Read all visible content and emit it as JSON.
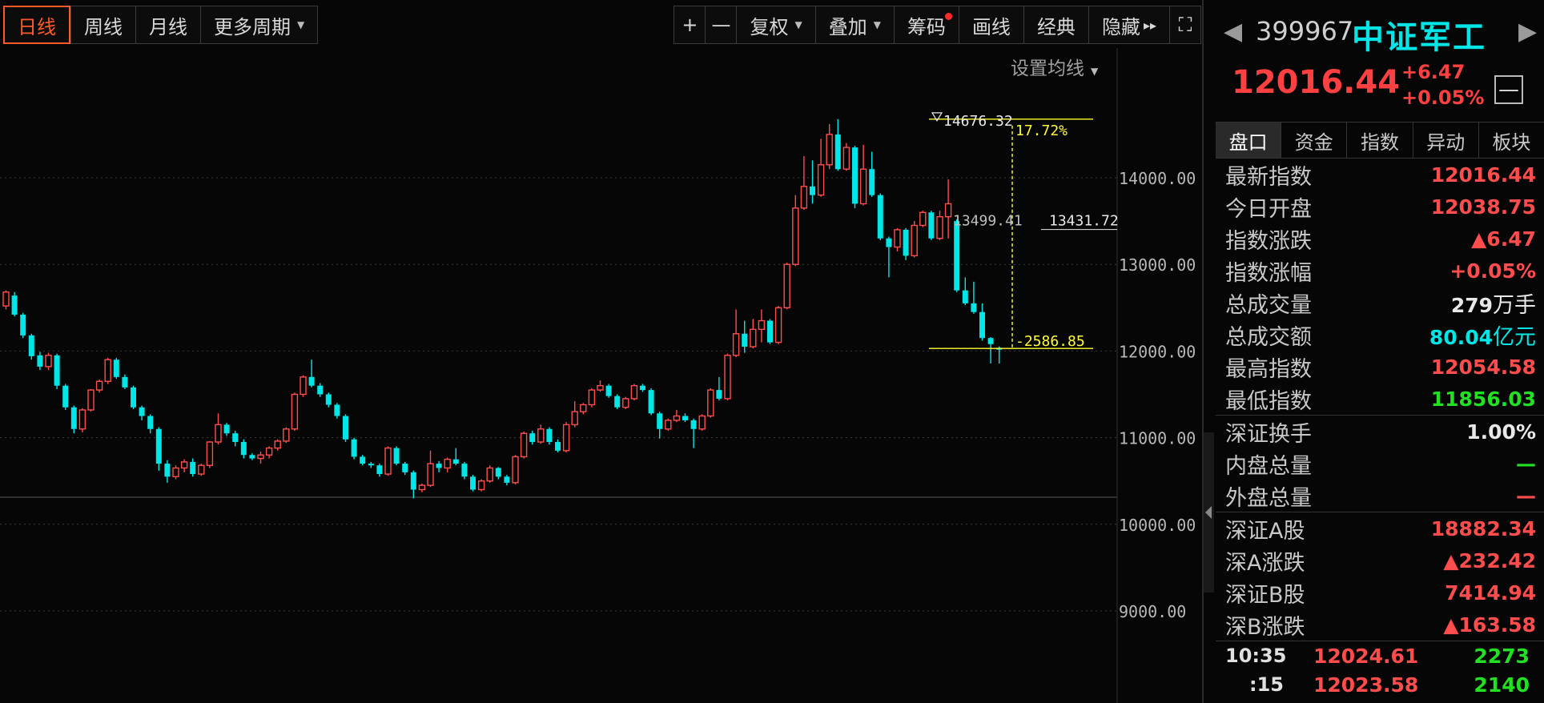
{
  "toolbar": {
    "periods": [
      "日线",
      "周线",
      "月线",
      "更多周期"
    ],
    "tools": [
      "复权",
      "叠加",
      "筹码",
      "画线",
      "经典",
      "隐藏"
    ],
    "plus_label": "+",
    "minus_label": "—",
    "hide_arrows": "▸▸",
    "expand_label": "⛶"
  },
  "chart": {
    "set_ma_label": "设置均线",
    "y_ticks": [
      "14000.00",
      "13000.00",
      "12000.00",
      "11000.00",
      "10000.00",
      "9000.00"
    ]
  },
  "chart_data": {
    "type": "candlestick",
    "y_axis_ticks": [
      14000,
      13000,
      12000,
      11000,
      10000,
      9000
    ],
    "annotations": {
      "high_label": "14676.32",
      "range_pct": "17.72%",
      "range_diff": "-2586.85",
      "mid_labels": [
        "13499.41",
        "13431.72"
      ]
    },
    "candles": [
      [
        12520,
        12680,
        12480,
        12700
      ],
      [
        12640,
        12420,
        12400,
        12680
      ],
      [
        12420,
        12180,
        12150,
        12440
      ],
      [
        12180,
        11940,
        11900,
        12200
      ],
      [
        11950,
        11820,
        11780,
        11990
      ],
      [
        11820,
        11950,
        11780,
        11980
      ],
      [
        11950,
        11600,
        11560,
        11970
      ],
      [
        11600,
        11350,
        11320,
        11620
      ],
      [
        11350,
        11100,
        11050,
        11370
      ],
      [
        11100,
        11320,
        11060,
        11340
      ],
      [
        11320,
        11550,
        11300,
        11560
      ],
      [
        11550,
        11650,
        11520,
        11670
      ],
      [
        11650,
        11900,
        11620,
        11920
      ],
      [
        11900,
        11700,
        11680,
        11920
      ],
      [
        11700,
        11580,
        11560,
        11730
      ],
      [
        11580,
        11350,
        11330,
        11600
      ],
      [
        11350,
        11250,
        11200,
        11370
      ],
      [
        11250,
        11100,
        11050,
        11270
      ],
      [
        11100,
        10700,
        10620,
        11120
      ],
      [
        10700,
        10550,
        10480,
        10740
      ],
      [
        10550,
        10650,
        10520,
        10680
      ],
      [
        10650,
        10720,
        10600,
        10750
      ],
      [
        10720,
        10580,
        10550,
        10760
      ],
      [
        10580,
        10680,
        10560,
        10700
      ],
      [
        10680,
        10950,
        10650,
        10960
      ],
      [
        10950,
        11150,
        10920,
        11280
      ],
      [
        11150,
        11050,
        11020,
        11170
      ],
      [
        11050,
        10950,
        10900,
        11080
      ],
      [
        10950,
        10800,
        10760,
        10980
      ],
      [
        10800,
        10760,
        10740,
        10820
      ],
      [
        10760,
        10800,
        10700,
        10840
      ],
      [
        10800,
        10880,
        10760,
        10900
      ],
      [
        10880,
        10960,
        10850,
        10980
      ],
      [
        10960,
        11100,
        10940,
        11120
      ],
      [
        11100,
        11500,
        11080,
        11520
      ],
      [
        11500,
        11700,
        11470,
        11720
      ],
      [
        11700,
        11600,
        11580,
        11900
      ],
      [
        11600,
        11500,
        11470,
        11630
      ],
      [
        11500,
        11380,
        11350,
        11520
      ],
      [
        11380,
        11250,
        11220,
        11400
      ],
      [
        11250,
        10980,
        10950,
        11270
      ],
      [
        10980,
        10780,
        10750,
        11000
      ],
      [
        10780,
        10700,
        10680,
        10800
      ],
      [
        10700,
        10680,
        10650,
        10720
      ],
      [
        10680,
        10580,
        10550,
        10700
      ],
      [
        10580,
        10880,
        10560,
        10900
      ],
      [
        10880,
        10700,
        10680,
        10900
      ],
      [
        10700,
        10600,
        10570,
        10720
      ],
      [
        10600,
        10400,
        10300,
        10620
      ],
      [
        10400,
        10450,
        10370,
        10470
      ],
      [
        10450,
        10700,
        10430,
        10850
      ],
      [
        10700,
        10650,
        10600,
        10730
      ],
      [
        10650,
        10750,
        10600,
        10770
      ],
      [
        10750,
        10700,
        10680,
        10880
      ],
      [
        10700,
        10550,
        10520,
        10720
      ],
      [
        10550,
        10400,
        10380,
        10570
      ],
      [
        10400,
        10500,
        10380,
        10520
      ],
      [
        10500,
        10650,
        10480,
        10680
      ],
      [
        10650,
        10550,
        10520,
        10660
      ],
      [
        10550,
        10480,
        10450,
        10570
      ],
      [
        10480,
        10780,
        10460,
        10800
      ],
      [
        10780,
        11050,
        10760,
        11070
      ],
      [
        11050,
        10950,
        10920,
        11080
      ],
      [
        10950,
        11100,
        10930,
        11150
      ],
      [
        11100,
        10950,
        10920,
        11120
      ],
      [
        10950,
        10850,
        10830,
        10980
      ],
      [
        10850,
        11150,
        10830,
        11180
      ],
      [
        11150,
        11300,
        11120,
        11420
      ],
      [
        11300,
        11380,
        11270,
        11400
      ],
      [
        11380,
        11550,
        11350,
        11570
      ],
      [
        11550,
        11600,
        11530,
        11660
      ],
      [
        11600,
        11480,
        11460,
        11620
      ],
      [
        11480,
        11350,
        11330,
        11500
      ],
      [
        11350,
        11450,
        11330,
        11470
      ],
      [
        11450,
        11600,
        11430,
        11620
      ],
      [
        11600,
        11550,
        11530,
        11620
      ],
      [
        11550,
        11280,
        11260,
        11570
      ],
      [
        11280,
        11100,
        10990,
        11300
      ],
      [
        11100,
        11200,
        11080,
        11220
      ],
      [
        11200,
        11250,
        11180,
        11320
      ],
      [
        11250,
        11200,
        11180,
        11280
      ],
      [
        11200,
        11100,
        10880,
        11220
      ],
      [
        11100,
        11250,
        11080,
        11270
      ],
      [
        11250,
        11550,
        11230,
        11570
      ],
      [
        11550,
        11450,
        11430,
        11700
      ],
      [
        11450,
        11950,
        11430,
        11970
      ],
      [
        11950,
        12200,
        11930,
        12480
      ],
      [
        12200,
        12050,
        11980,
        12350
      ],
      [
        12050,
        12250,
        12030,
        12370
      ],
      [
        12250,
        12350,
        12100,
        12480
      ],
      [
        12350,
        12100,
        12080,
        12370
      ],
      [
        12100,
        12500,
        12080,
        12520
      ],
      [
        12500,
        13000,
        12480,
        13020
      ],
      [
        13000,
        13650,
        12980,
        13800
      ],
      [
        13650,
        13900,
        13630,
        14250
      ],
      [
        13900,
        13800,
        13700,
        14200
      ],
      [
        13800,
        14150,
        13780,
        14450
      ],
      [
        14150,
        14500,
        14100,
        14620
      ],
      [
        14500,
        14100,
        14080,
        14676
      ],
      [
        14100,
        14350,
        14080,
        14400
      ],
      [
        14350,
        13700,
        13650,
        14370
      ],
      [
        13700,
        14100,
        13680,
        14380
      ],
      [
        14100,
        13800,
        13780,
        14300
      ],
      [
        13800,
        13300,
        13280,
        13820
      ],
      [
        13300,
        13200,
        12850,
        13320
      ],
      [
        13200,
        13400,
        13150,
        13420
      ],
      [
        13400,
        13100,
        13050,
        13420
      ],
      [
        13100,
        13450,
        13080,
        13500
      ],
      [
        13450,
        13600,
        13430,
        13620
      ],
      [
        13600,
        13300,
        13280,
        13620
      ],
      [
        13300,
        13550,
        13280,
        13620
      ],
      [
        13550,
        13700,
        13300,
        13980
      ],
      [
        13500,
        12700,
        12680,
        13520
      ],
      [
        12700,
        12550,
        12530,
        12850
      ],
      [
        12550,
        12450,
        12430,
        12800
      ],
      [
        12450,
        12150,
        12120,
        12550
      ],
      [
        12150,
        12080,
        11856,
        12160
      ],
      [
        12038,
        12016,
        11856,
        12054
      ]
    ]
  },
  "right": {
    "prev_icon": "◀",
    "next_icon": "▶",
    "code": "399967",
    "name": "中证军工",
    "price": "12016.44",
    "change": "+6.47",
    "change_pct": "+0.05%",
    "collapse_icon": "—",
    "tabs": [
      "盘口",
      "资金",
      "指数",
      "异动",
      "板块"
    ],
    "stats": [
      {
        "label": "最新指数",
        "value": "12016.44"
      },
      {
        "label": "今日开盘",
        "value": "12038.75"
      },
      {
        "label": "指数涨跌",
        "value": "▲6.47"
      },
      {
        "label": "指数涨幅",
        "value": "+0.05%"
      },
      {
        "label": "总成交量",
        "value": "279",
        "unit": "万手"
      },
      {
        "label": "总成交额",
        "value": "80.04",
        "unit": "亿元"
      },
      {
        "label": "最高指数",
        "value": "12054.58"
      },
      {
        "label": "最低指数",
        "value": "11856.03"
      }
    ],
    "turnover": [
      {
        "label": "深证换手",
        "value": "1.00%"
      },
      {
        "label": "内盘总量",
        "value": "—"
      },
      {
        "label": "外盘总量",
        "value": "—"
      }
    ],
    "market": [
      {
        "label": "深证A股",
        "value": "18882.34"
      },
      {
        "label": "深A涨跌",
        "value": "▲232.42"
      },
      {
        "label": "深证B股",
        "value": "7414.94"
      },
      {
        "label": "深B涨跌",
        "value": "▲163.58"
      }
    ],
    "ticks": [
      {
        "time": "10:35",
        "price": "12024.61",
        "vol": "2273"
      },
      {
        "time": ":15",
        "price": "12023.58",
        "vol": "2140"
      }
    ]
  },
  "colors": {
    "up": "#ff4d4d",
    "down": "#00e6e6",
    "accent": "#ff5a28",
    "annotation": "#ffff33"
  }
}
